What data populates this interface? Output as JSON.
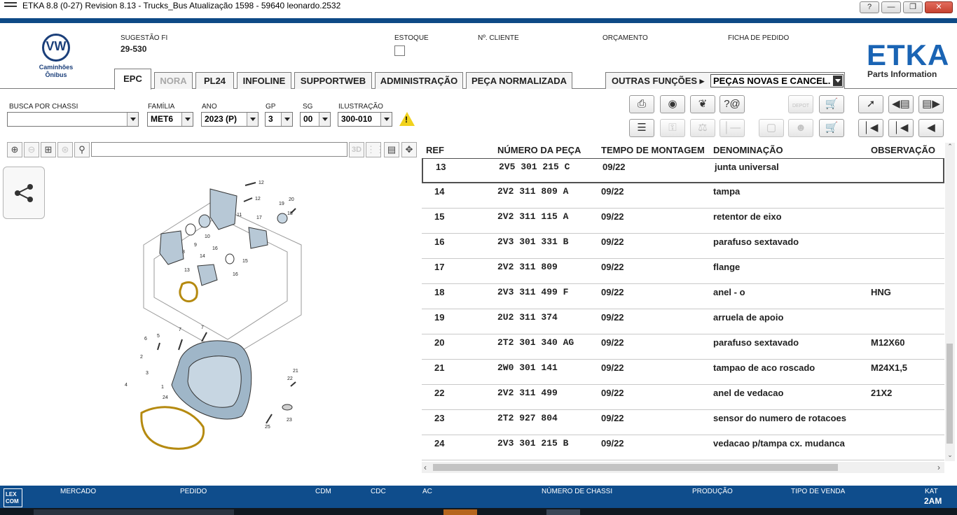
{
  "window": {
    "title": "ETKA 8.8 (0-27) Revision 8.13 - Trucks_Bus Atualização 1598 - 59640 leonardo.2532",
    "help": "?",
    "minimize": "—",
    "restore": "❐",
    "close": "✕"
  },
  "brand": {
    "vw_mark": "VW",
    "vw_caption": "Caminhões\nÔnibus",
    "etka": "ETKA",
    "etka_sub": "Parts Information"
  },
  "header": {
    "sugestao_label": "SUGESTÃO FI",
    "sugestao_value": "29-530",
    "estoque_label": "ESTOQUE",
    "cliente_label": "Nº. CLIENTE",
    "orcamento_label": "ORÇAMENTO",
    "ficha_label": "FICHA DE PEDIDO"
  },
  "tabs": [
    {
      "label": "EPC"
    },
    {
      "label": "NORA"
    },
    {
      "label": "PL24"
    },
    {
      "label": "INFOLINE"
    },
    {
      "label": "SUPPORTWEB"
    },
    {
      "label": "ADMINISTRAÇÃO"
    },
    {
      "label": "PEÇA NORMALIZADA"
    }
  ],
  "outras": {
    "label": "OUTRAS FUNÇÕES ▸",
    "selected": "PEÇAS NOVAS E CANCEL."
  },
  "filters": {
    "chassi_label": "BUSCA POR CHASSI",
    "chassi_value": "",
    "familia_label": "FAMÍLIA",
    "familia_value": "MET6",
    "ano_label": "ANO",
    "ano_value": "2023 (P)",
    "gp_label": "GP",
    "gp_value": "3",
    "sg_label": "SG",
    "sg_value": "00",
    "ilustracao_label": "ILUSTRAÇÃO",
    "ilustracao_value": "300-010",
    "warning": "!"
  },
  "toolbar": {
    "depot_label": "DEPOT"
  },
  "illustration": {
    "search_value": "",
    "btn_3d": "3D",
    "callouts": [
      "12",
      "12",
      "11",
      "20",
      "19",
      "18",
      "17",
      "9",
      "10",
      "8",
      "16",
      "14",
      "13",
      "15",
      "16",
      "7",
      "7",
      "6",
      "5",
      "2",
      "3",
      "4",
      "1",
      "22",
      "21",
      "24",
      "25",
      "23"
    ]
  },
  "table": {
    "headers": {
      "ref": "REF",
      "numero": "NÚMERO DA PEÇA",
      "tempo": "TEMPO DE MONTAGEM",
      "denominacao": "DENOMINAÇÃO",
      "observacao": "OBSERVAÇÃO"
    },
    "rows": [
      {
        "ref": "13",
        "numero": "2V5 301 215 C",
        "tempo": "09/22",
        "denominacao": "junta universal",
        "observacao": ""
      },
      {
        "ref": "14",
        "numero": "2V2 311 809 A",
        "tempo": "09/22",
        "denominacao": "tampa",
        "observacao": ""
      },
      {
        "ref": "15",
        "numero": "2V2 311 115 A",
        "tempo": "09/22",
        "denominacao": "retentor de eixo",
        "observacao": ""
      },
      {
        "ref": "16",
        "numero": "2V3 301 331 B",
        "tempo": "09/22",
        "denominacao": "parafuso sextavado",
        "observacao": ""
      },
      {
        "ref": "17",
        "numero": "2V2 311 809",
        "tempo": "09/22",
        "denominacao": "flange",
        "observacao": ""
      },
      {
        "ref": "18",
        "numero": "2V3 311 499 F",
        "tempo": "09/22",
        "denominacao": "anel - o",
        "observacao": "HNG"
      },
      {
        "ref": "19",
        "numero": "2U2 311 374",
        "tempo": "09/22",
        "denominacao": "arruela de apoio",
        "observacao": ""
      },
      {
        "ref": "20",
        "numero": "2T2 301 340 AG",
        "tempo": "09/22",
        "denominacao": "parafuso sextavado",
        "observacao": "M12X60"
      },
      {
        "ref": "21",
        "numero": "2W0 301 141",
        "tempo": "09/22",
        "denominacao": "tampao de aco roscado",
        "observacao": "M24X1,5"
      },
      {
        "ref": "22",
        "numero": "2V2 311 499",
        "tempo": "09/22",
        "denominacao": "anel de vedacao",
        "observacao": "21X2"
      },
      {
        "ref": "23",
        "numero": "2T2 927 804",
        "tempo": "09/22",
        "denominacao": "sensor do numero de rotacoes",
        "observacao": ""
      },
      {
        "ref": "24",
        "numero": "2V3 301 215 B",
        "tempo": "09/22",
        "denominacao": "vedacao p/tampa cx. mudanca",
        "observacao": ""
      }
    ]
  },
  "status": {
    "logo": "LEX\nCOM",
    "mercado": "MERCADO",
    "pedido": "PEDIDO",
    "cdm": "CDM",
    "cdc": "CDC",
    "ac": "AC",
    "chassi": "NÚMERO DE CHASSI",
    "producao": "PRODUÇÃO",
    "tipo_venda": "TIPO DE VENDA",
    "kat_label": "KAT",
    "kat_value": "2AM"
  },
  "colors": {
    "bar_blue": "#0f4d8c",
    "etka_blue": "#1a64b4",
    "vw_blue": "#1b3f7a",
    "warning_yellow": "#f1d21c",
    "highlight_callout": "#e8c23a"
  },
  "icons": [
    "printer-icon",
    "cd-icon",
    "handshake-icon",
    "help-icon",
    "depot-icon",
    "cart-add-icon",
    "pin-icon",
    "prev-page-icon",
    "next-page-icon",
    "list-icon",
    "key-icon",
    "scale-icon",
    "minus-icon",
    "monitor-icon",
    "person-icon",
    "cart-icon",
    "first-icon",
    "prev-icon",
    "back-icon",
    "share-icon",
    "zoom-in-icon",
    "zoom-out-icon",
    "zoom-fit-icon",
    "zoom-area-icon",
    "search-icon"
  ]
}
